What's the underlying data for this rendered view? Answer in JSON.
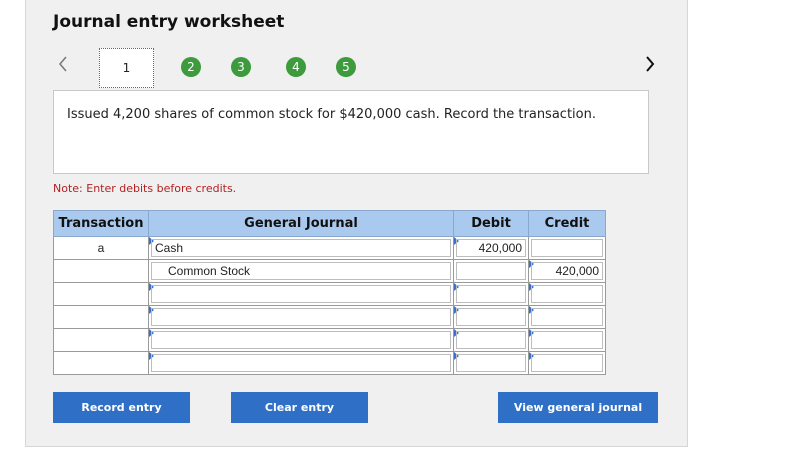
{
  "title": "Journal entry worksheet",
  "steps": {
    "current": "1",
    "others": [
      "2",
      "3",
      "4",
      "5"
    ]
  },
  "nav": {
    "prev_icon": "chevron-left-icon",
    "next_icon": "chevron-right-icon"
  },
  "description": "Issued 4,200 shares of common stock for $420,000 cash. Record the transaction.",
  "note": "Note: Enter debits before credits.",
  "table": {
    "headers": {
      "transaction": "Transaction",
      "journal": "General Journal",
      "debit": "Debit",
      "credit": "Credit"
    },
    "rows": [
      {
        "transaction": "a",
        "account": "Cash",
        "debit": "420,000",
        "credit": ""
      },
      {
        "transaction": "",
        "account": "Common Stock",
        "debit": "",
        "credit": "420,000"
      },
      {
        "transaction": "",
        "account": "",
        "debit": "",
        "credit": ""
      },
      {
        "transaction": "",
        "account": "",
        "debit": "",
        "credit": ""
      },
      {
        "transaction": "",
        "account": "",
        "debit": "",
        "credit": ""
      },
      {
        "transaction": "",
        "account": "",
        "debit": "",
        "credit": ""
      }
    ]
  },
  "buttons": {
    "record": "Record entry",
    "clear": "Clear entry",
    "view": "View general journal"
  },
  "colors": {
    "header_bg": "#a9c9ee",
    "button_bg": "#2f6fc5",
    "step_bg": "#3d9a3d",
    "note": "#b22222"
  }
}
